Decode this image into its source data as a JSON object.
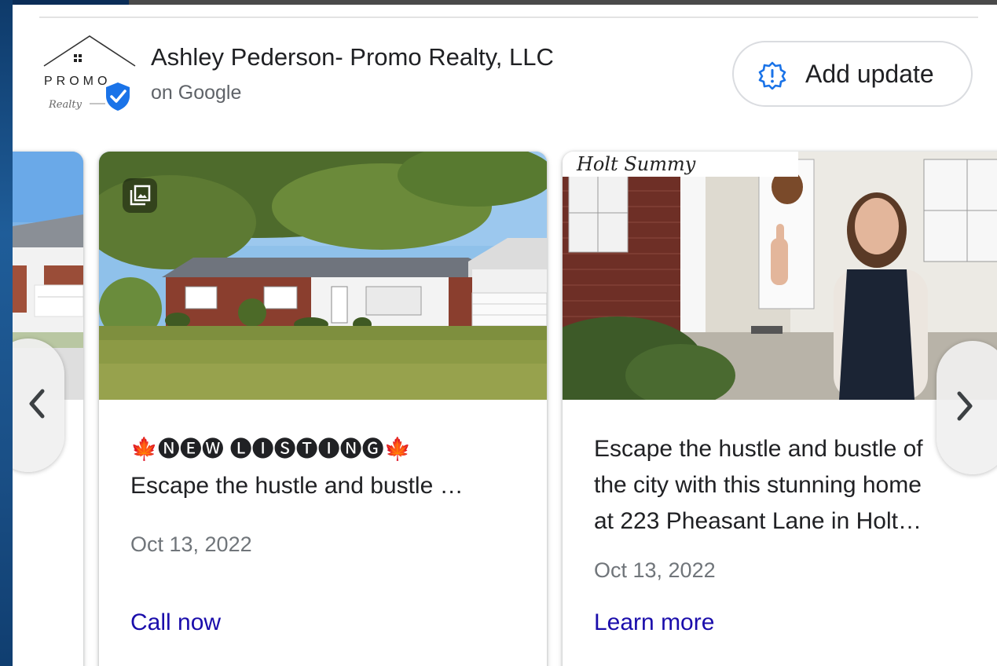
{
  "business": {
    "name": "Ashley Pederson- Promo Realty, LLC",
    "subtitle": "on Google",
    "logo_text": "PROMO",
    "logo_script": "Realty"
  },
  "actions": {
    "add_update_label": "Add update"
  },
  "posts": [
    {
      "headline": "🍁🅝🅔🅦 🅛🅘🅢🅣🅘🅝🅖🍁",
      "text": "Escape the hustle and bustle …",
      "date": "Oct 13, 2022",
      "cta": "Call now"
    },
    {
      "text_lines": [
        "Escape the hustle and bustle of",
        "the city with this stunning home",
        "at 223 Pheasant Lane in Holt…"
      ],
      "date": "Oct 13, 2022",
      "cta": "Learn more",
      "photo_caption": "Holt Summy"
    }
  ],
  "colors": {
    "link": "#1a0dab",
    "verified_badge": "#1a73e8",
    "text_primary": "#202124",
    "text_secondary": "#70757a"
  },
  "icons": {
    "add_update": "alert-badge-icon",
    "gallery": "photo-gallery-icon",
    "prev": "chevron-left-icon",
    "next": "chevron-right-icon",
    "verified": "verified-shield-icon"
  }
}
